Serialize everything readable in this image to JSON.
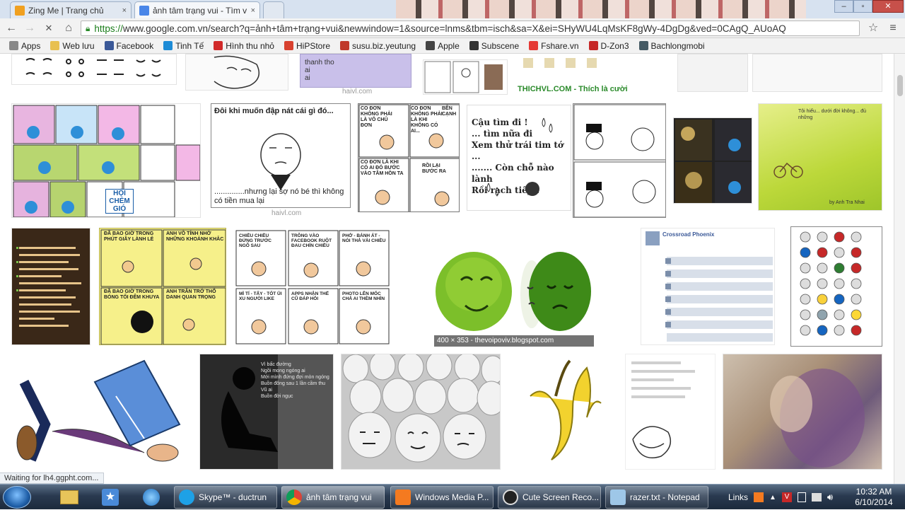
{
  "tabs": [
    {
      "title": "Zing Me | Trang chủ",
      "close": "×",
      "favicon_color": "#f0a020"
    },
    {
      "title": "ảnh tâm trạng vui - Tìm v",
      "close": "×",
      "favicon_color": "#4a86e8"
    }
  ],
  "window_controls": {
    "minimize": "–",
    "maximize": "▫",
    "close": "✕"
  },
  "toolbar": {
    "back": "←",
    "forward": "→",
    "reload": "✕",
    "home": "⌂",
    "star": "☆",
    "menu": "≡",
    "url_scheme": "https://",
    "url_rest": "www.google.com.vn/search?q=ảnh+tâm+trạng+vui&newwindow=1&source=lnms&tbm=isch&sa=X&ei=SHyWU4LqMsKF8gWy-4DgDg&ved=0CAgQ_AUoAQ"
  },
  "bookmarks": [
    {
      "label": "Apps",
      "icon": "apps-grid-icon",
      "color": "#888"
    },
    {
      "label": "Web lưu",
      "icon": "folder-icon",
      "color": "#e8c050"
    },
    {
      "label": "Facebook",
      "icon": "facebook-icon",
      "color": "#3b5998"
    },
    {
      "label": "Tinh Tế",
      "icon": "tinhte-icon",
      "color": "#1d8bd6"
    },
    {
      "label": "Hình thu nhỏ",
      "icon": "youtube-icon",
      "color": "#d12a2a"
    },
    {
      "label": "HiPStore",
      "icon": "hipstore-icon",
      "color": "#d8412f"
    },
    {
      "label": "susu.biz.yeutung",
      "icon": "susu-icon",
      "color": "#c0392b"
    },
    {
      "label": "Apple",
      "icon": "apple-icon",
      "color": "#444"
    },
    {
      "label": "Subscene",
      "icon": "subscene-icon",
      "color": "#333"
    },
    {
      "label": "Fshare.vn",
      "icon": "fshare-icon",
      "color": "#e53935"
    },
    {
      "label": "D-Zon3",
      "icon": "dzone-icon",
      "color": "#c62828"
    },
    {
      "label": "Bachlongmobi",
      "icon": "bachlong-icon",
      "color": "#455a64"
    }
  ],
  "thumbnails": {
    "meme_caption_1": "Đôi khi muốn đập nát cái gì đó...",
    "meme_caption_2": "..............nhưng lại sợ nó bé thì không có tiền mua lại",
    "meme_source": "haivl.com",
    "heart_text_1": "Cậu tìm đi !",
    "heart_text_2": "... tìm nữa đi",
    "heart_text_3": "Xem thử trái tim tớ ...",
    "heart_text_4": "....... Còn chỗ nào lành",
    "heart_text_5": "Rồi rạch tiếp !",
    "thichvl_caption": "THICHVL.COM - Thích là cười",
    "apple_caption": "400 × 353 - thevoipoviv.blogspot.com",
    "nobita_bubble_1": "CO ĐƠN KHÔNG PHẢI LÀ VÔ CHỦ ĐƠN",
    "nobita_bubble_2": "CO ĐƠN KHÔNG PHẢI LÀ KHI KHÔNG CÓ AI...",
    "nobita_bubble_3": "BÊN CẠNH",
    "nobita_bubble_4": "CO ĐƠN LÀ KHI CÓ AI ĐÓ BƯỚC VÀO TÂM HỒN TA",
    "nobita_bubble_5": "RỒI LẠI BƯỚC RA",
    "doraemon_bubble_1": "HỘI CHÉM GIÓ",
    "comic_bubble_1": "CHIỀU CHIỀU ĐỨNG TRƯỚC NGÕ SAU",
    "comic_bubble_2": "TRÔNG VÀO FACEBOOK RUỘT ĐAU CHÍN CHIỀU",
    "comic_bubble_3": "PHỞ - BÁNH ÁT - NÓI THẢ VÀI CHIỀU",
    "comic_bubble_4": "MÌ TÍ - TẨY - TỐT ỦI XU NGƯỜI LIKE",
    "comic_bubble_5": "APPS NHẬN THẾ CŨ ĐÁP HỎI",
    "comic_bubble_6": "PHOTO LÊN MỐC CHẢ AI THÈM NHÌN",
    "yellow_comic_1": "ĐÃ BAO GIỜ TRONG PHÚT GIÂY LÀNH LẺ",
    "yellow_comic_2": "ANH VỒ TÍNH NHỚ NHỮNG KHOẢNH KHẮC",
    "yellow_comic_3": "ĐÃ BAO GIỜ TRONG BÓNG TỐI ĐÊM KHUYA",
    "yellow_comic_4": "ANH TRĂN TRỞ THỔ DANH QUAN TRỌNG",
    "forever_alone_1": "Tôi hiểu... dưới đời không... đủ những",
    "forever_alone_2": "by Anh Tra Nhai",
    "facebook_header": "Crossroad Phoenix",
    "poem_1": "Vì bấc đường",
    "poem_2": "Ngồi mong ngóng ai",
    "poem_3": "Mới mình đứng đợi mòn ngóng",
    "poem_4": "Buồn đông sau 1 lần cầm thu",
    "poem_5": "Vũ ai",
    "poem_6": "Buồn đời ngục"
  },
  "status_bubble": "Waiting for lh4.ggpht.com...",
  "taskbar": {
    "items": [
      {
        "label": "Skype™ - ductrun",
        "color": "#1ea1e6"
      },
      {
        "label": "ảnh tâm trạng vui",
        "color": "#e8b33a"
      },
      {
        "label": "Windows Media P...",
        "color": "#f47a20"
      },
      {
        "label": "Cute Screen Reco...",
        "color": "#222"
      },
      {
        "label": "razer.txt - Notepad",
        "color": "#9ec7e8"
      }
    ],
    "tray_label": "Links",
    "time": "10:32 AM",
    "date": "6/10/2014"
  }
}
